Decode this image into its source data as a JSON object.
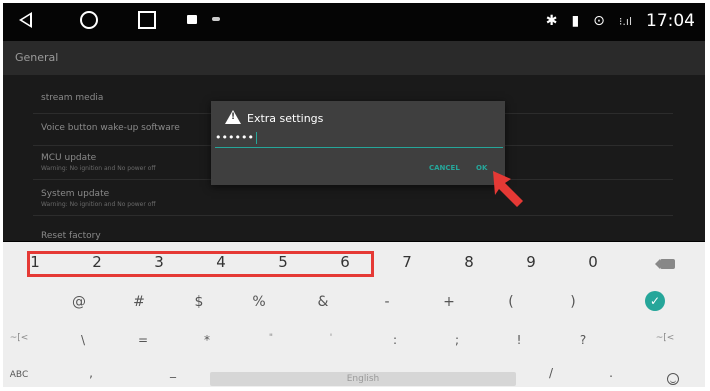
{
  "status_bar": {
    "time": "17:04",
    "bluetooth": "✱",
    "battery": "▮",
    "location": "⊙",
    "signal": "⁝.ıl"
  },
  "header": {
    "title": "General"
  },
  "settings_items": [
    {
      "label": "stream media",
      "sub": ""
    },
    {
      "label": "Voice button wake-up software",
      "sub": ""
    },
    {
      "label": "MCU update",
      "sub": "Warning: No ignition and No power off"
    },
    {
      "label": "System update",
      "sub": "Warning: No ignition and No power off"
    },
    {
      "label": "Reset factory",
      "sub": ""
    }
  ],
  "dialog": {
    "title": "Extra settings",
    "input_value": "••••••",
    "cancel_label": "CANCEL",
    "ok_label": "OK"
  },
  "keyboard": {
    "row1": [
      "1",
      "2",
      "3",
      "4",
      "5",
      "6",
      "7",
      "8",
      "9",
      "0"
    ],
    "row2": [
      "@",
      "#",
      "$",
      "%",
      "&",
      "-",
      "+",
      "(",
      ")"
    ],
    "row3": [
      "~[<",
      "\\",
      "=",
      "*",
      "\"",
      "'",
      ":",
      ";",
      "!",
      "?",
      "~[<"
    ],
    "row4_left": [
      "ABC",
      ",",
      "_"
    ],
    "space_label": "English",
    "row4_right": [
      "/",
      "."
    ],
    "check": "✓"
  },
  "colors": {
    "accent": "#26a69a",
    "highlight": "#e53935",
    "pointer": "#e53935"
  }
}
